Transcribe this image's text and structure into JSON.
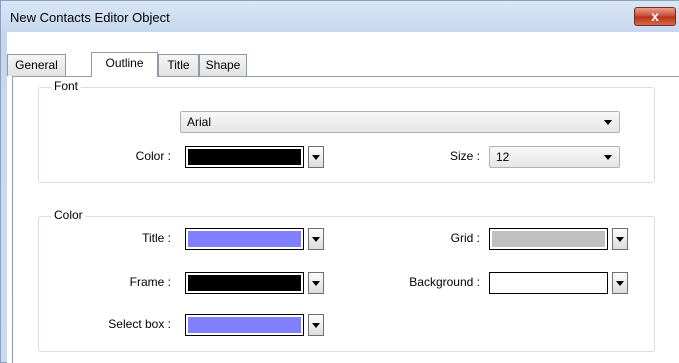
{
  "window": {
    "title": "New Contacts Editor Object",
    "close_label": "x"
  },
  "tabs": [
    {
      "label": "General",
      "active": false
    },
    {
      "label": "Outline",
      "active": true
    },
    {
      "label": "Title",
      "active": false
    },
    {
      "label": "Shape",
      "active": false
    }
  ],
  "font_group": {
    "label": "Font",
    "font_value": "Arial",
    "color_label": "Color :",
    "color_value": "#000000",
    "size_label": "Size :",
    "size_value": "12"
  },
  "color_group": {
    "label": "Color",
    "title_label": "Title :",
    "title_color": "#8080ff",
    "grid_label": "Grid :",
    "grid_color": "#c0c0c0",
    "frame_label": "Frame :",
    "frame_color": "#000000",
    "background_label": "Background :",
    "background_color": "#ffffff",
    "select_box_label": "Select box :",
    "select_box_color": "#8080ff"
  },
  "icons": {
    "close": "close-icon",
    "dropdown": "chevron-down-icon"
  }
}
